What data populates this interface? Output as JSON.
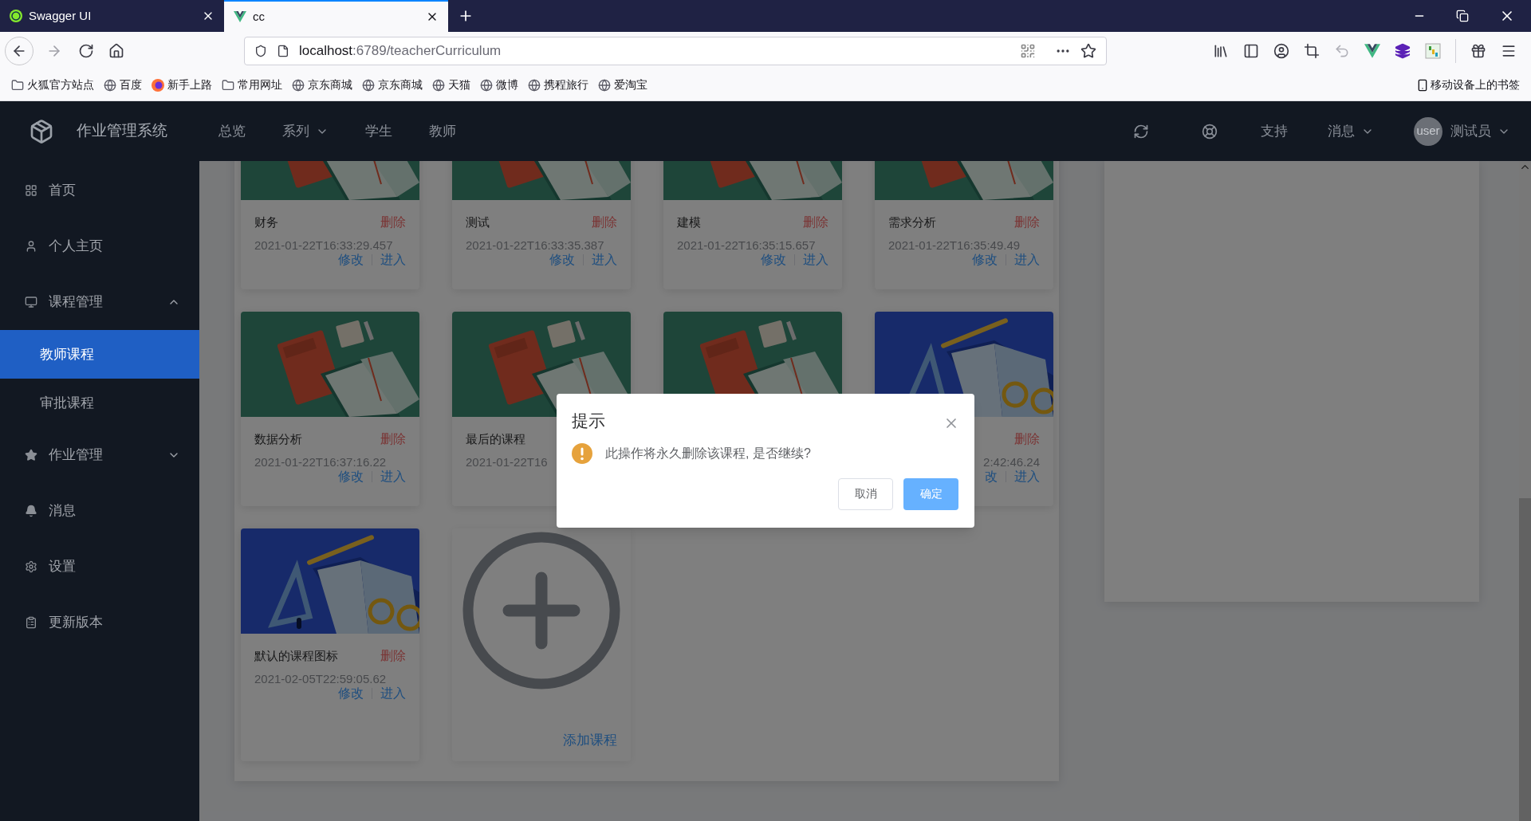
{
  "browser": {
    "tabs": [
      {
        "title": "Swagger UI",
        "selected": false
      },
      {
        "title": "cc",
        "selected": true
      }
    ],
    "url": {
      "host": "localhost",
      "path": ":6789/teacherCurriculum"
    },
    "bookmarks": [
      {
        "label": "火狐官方站点",
        "kind": "folder"
      },
      {
        "label": "百度",
        "kind": "site"
      },
      {
        "label": "新手上路",
        "kind": "starter"
      },
      {
        "label": "常用网址",
        "kind": "folder"
      },
      {
        "label": "京东商城",
        "kind": "site"
      },
      {
        "label": "京东商城",
        "kind": "site"
      },
      {
        "label": "天猫",
        "kind": "site"
      },
      {
        "label": "微博",
        "kind": "site"
      },
      {
        "label": "携程旅行",
        "kind": "site"
      },
      {
        "label": "爱淘宝",
        "kind": "site"
      }
    ],
    "mobile_bookmarks": "移动设备上的书签"
  },
  "header": {
    "title": "作业管理系统",
    "nav": [
      {
        "label": "总览",
        "dropdown": false
      },
      {
        "label": "系列",
        "dropdown": true
      },
      {
        "label": "学生",
        "dropdown": false
      },
      {
        "label": "教师",
        "dropdown": false
      }
    ],
    "links": [
      {
        "label": "支持",
        "dropdown": false
      },
      {
        "label": "消息",
        "dropdown": true
      }
    ],
    "avatar_text": "user",
    "user": "测试员"
  },
  "sidebar": {
    "items": [
      {
        "label": "首页"
      },
      {
        "label": "个人主页"
      },
      {
        "label": "课程管理",
        "expanded": true,
        "children": [
          {
            "label": "教师课程",
            "selected": true
          },
          {
            "label": "审批课程",
            "selected": false
          }
        ]
      },
      {
        "label": "作业管理",
        "expanded": false
      },
      {
        "label": "消息"
      },
      {
        "label": "设置"
      },
      {
        "label": "更新版本"
      }
    ]
  },
  "courses": [
    {
      "title": "财务",
      "delete": "删除",
      "time": "2021-01-22T16:33:29.457",
      "edit": "修改",
      "enter": "进入",
      "kind": "notebook"
    },
    {
      "title": "测试",
      "delete": "删除",
      "time": "2021-01-22T16:33:35.387",
      "edit": "修改",
      "enter": "进入",
      "kind": "notebook"
    },
    {
      "title": "建模",
      "delete": "删除",
      "time": "2021-01-22T16:35:15.657",
      "edit": "修改",
      "enter": "进入",
      "kind": "notebook"
    },
    {
      "title": "需求分析",
      "delete": "删除",
      "time": "2021-01-22T16:35:49.49",
      "edit": "修改",
      "enter": "进入",
      "kind": "notebook"
    },
    {
      "title": "数据分析",
      "delete": "删除",
      "time": "2021-01-22T16:37:16.22",
      "edit": "修改",
      "enter": "进入",
      "kind": "notebook"
    },
    {
      "title": "最后的课程",
      "time": "2021-01-22T16",
      "kind": "notebook"
    },
    {
      "kind": "notebook"
    },
    {
      "delete": "删除",
      "time": "2:42:46.24",
      "edit": "改",
      "enter": "进入",
      "kind": "geometry"
    },
    {
      "title": "默认的课程图标",
      "delete": "删除",
      "time": "2021-02-05T22:59:05.62",
      "edit": "修改",
      "enter": "进入",
      "kind": "geometry"
    }
  ],
  "add_course": "添加课程",
  "dialog": {
    "title": "提示",
    "message": "此操作将永久删除该课程, 是否继续?",
    "buttons": [
      {
        "label": "取消",
        "kind": "default"
      },
      {
        "label": "确定",
        "kind": "primary"
      }
    ]
  }
}
